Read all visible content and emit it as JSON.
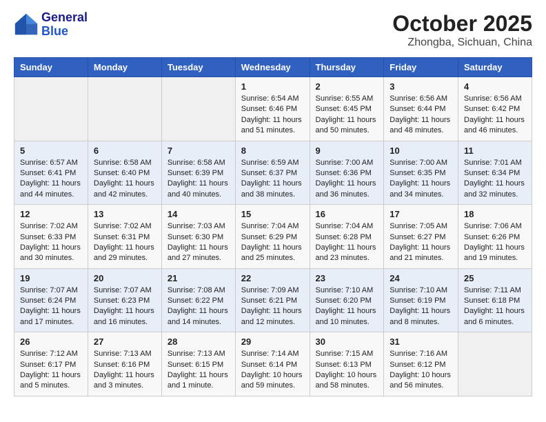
{
  "header": {
    "logo_line1": "General",
    "logo_line2": "Blue",
    "month_title": "October 2025",
    "location": "Zhongba, Sichuan, China"
  },
  "weekdays": [
    "Sunday",
    "Monday",
    "Tuesday",
    "Wednesday",
    "Thursday",
    "Friday",
    "Saturday"
  ],
  "weeks": [
    [
      {
        "day": "",
        "info": ""
      },
      {
        "day": "",
        "info": ""
      },
      {
        "day": "",
        "info": ""
      },
      {
        "day": "1",
        "info": "Sunrise: 6:54 AM\nSunset: 6:46 PM\nDaylight: 11 hours\nand 51 minutes."
      },
      {
        "day": "2",
        "info": "Sunrise: 6:55 AM\nSunset: 6:45 PM\nDaylight: 11 hours\nand 50 minutes."
      },
      {
        "day": "3",
        "info": "Sunrise: 6:56 AM\nSunset: 6:44 PM\nDaylight: 11 hours\nand 48 minutes."
      },
      {
        "day": "4",
        "info": "Sunrise: 6:56 AM\nSunset: 6:42 PM\nDaylight: 11 hours\nand 46 minutes."
      }
    ],
    [
      {
        "day": "5",
        "info": "Sunrise: 6:57 AM\nSunset: 6:41 PM\nDaylight: 11 hours\nand 44 minutes."
      },
      {
        "day": "6",
        "info": "Sunrise: 6:58 AM\nSunset: 6:40 PM\nDaylight: 11 hours\nand 42 minutes."
      },
      {
        "day": "7",
        "info": "Sunrise: 6:58 AM\nSunset: 6:39 PM\nDaylight: 11 hours\nand 40 minutes."
      },
      {
        "day": "8",
        "info": "Sunrise: 6:59 AM\nSunset: 6:37 PM\nDaylight: 11 hours\nand 38 minutes."
      },
      {
        "day": "9",
        "info": "Sunrise: 7:00 AM\nSunset: 6:36 PM\nDaylight: 11 hours\nand 36 minutes."
      },
      {
        "day": "10",
        "info": "Sunrise: 7:00 AM\nSunset: 6:35 PM\nDaylight: 11 hours\nand 34 minutes."
      },
      {
        "day": "11",
        "info": "Sunrise: 7:01 AM\nSunset: 6:34 PM\nDaylight: 11 hours\nand 32 minutes."
      }
    ],
    [
      {
        "day": "12",
        "info": "Sunrise: 7:02 AM\nSunset: 6:33 PM\nDaylight: 11 hours\nand 30 minutes."
      },
      {
        "day": "13",
        "info": "Sunrise: 7:02 AM\nSunset: 6:31 PM\nDaylight: 11 hours\nand 29 minutes."
      },
      {
        "day": "14",
        "info": "Sunrise: 7:03 AM\nSunset: 6:30 PM\nDaylight: 11 hours\nand 27 minutes."
      },
      {
        "day": "15",
        "info": "Sunrise: 7:04 AM\nSunset: 6:29 PM\nDaylight: 11 hours\nand 25 minutes."
      },
      {
        "day": "16",
        "info": "Sunrise: 7:04 AM\nSunset: 6:28 PM\nDaylight: 11 hours\nand 23 minutes."
      },
      {
        "day": "17",
        "info": "Sunrise: 7:05 AM\nSunset: 6:27 PM\nDaylight: 11 hours\nand 21 minutes."
      },
      {
        "day": "18",
        "info": "Sunrise: 7:06 AM\nSunset: 6:26 PM\nDaylight: 11 hours\nand 19 minutes."
      }
    ],
    [
      {
        "day": "19",
        "info": "Sunrise: 7:07 AM\nSunset: 6:24 PM\nDaylight: 11 hours\nand 17 minutes."
      },
      {
        "day": "20",
        "info": "Sunrise: 7:07 AM\nSunset: 6:23 PM\nDaylight: 11 hours\nand 16 minutes."
      },
      {
        "day": "21",
        "info": "Sunrise: 7:08 AM\nSunset: 6:22 PM\nDaylight: 11 hours\nand 14 minutes."
      },
      {
        "day": "22",
        "info": "Sunrise: 7:09 AM\nSunset: 6:21 PM\nDaylight: 11 hours\nand 12 minutes."
      },
      {
        "day": "23",
        "info": "Sunrise: 7:10 AM\nSunset: 6:20 PM\nDaylight: 11 hours\nand 10 minutes."
      },
      {
        "day": "24",
        "info": "Sunrise: 7:10 AM\nSunset: 6:19 PM\nDaylight: 11 hours\nand 8 minutes."
      },
      {
        "day": "25",
        "info": "Sunrise: 7:11 AM\nSunset: 6:18 PM\nDaylight: 11 hours\nand 6 minutes."
      }
    ],
    [
      {
        "day": "26",
        "info": "Sunrise: 7:12 AM\nSunset: 6:17 PM\nDaylight: 11 hours\nand 5 minutes."
      },
      {
        "day": "27",
        "info": "Sunrise: 7:13 AM\nSunset: 6:16 PM\nDaylight: 11 hours\nand 3 minutes."
      },
      {
        "day": "28",
        "info": "Sunrise: 7:13 AM\nSunset: 6:15 PM\nDaylight: 11 hours\nand 1 minute."
      },
      {
        "day": "29",
        "info": "Sunrise: 7:14 AM\nSunset: 6:14 PM\nDaylight: 10 hours\nand 59 minutes."
      },
      {
        "day": "30",
        "info": "Sunrise: 7:15 AM\nSunset: 6:13 PM\nDaylight: 10 hours\nand 58 minutes."
      },
      {
        "day": "31",
        "info": "Sunrise: 7:16 AM\nSunset: 6:12 PM\nDaylight: 10 hours\nand 56 minutes."
      },
      {
        "day": "",
        "info": ""
      }
    ]
  ]
}
